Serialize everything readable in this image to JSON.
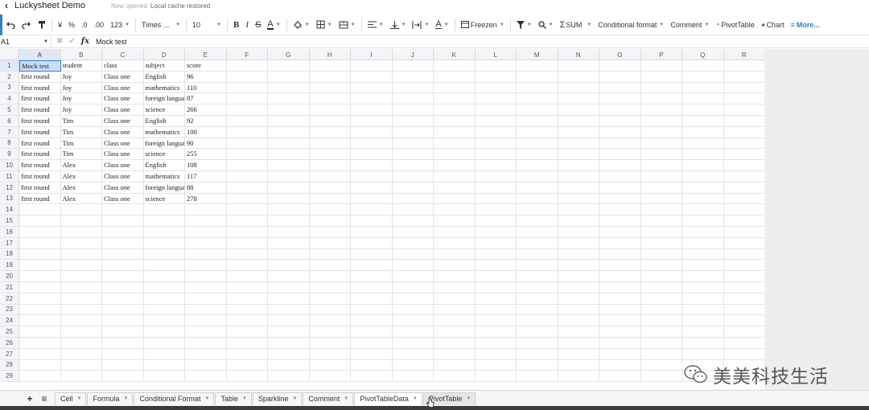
{
  "titlebar": {
    "title": "Luckysheet Demo",
    "status_opened": "New opened",
    "status_cache": "Local cache restored"
  },
  "toolbar": {
    "currency": "¥",
    "percent": "%",
    "dec_decrease": ".0",
    "dec_increase": ".00",
    "number_format": "123",
    "font_name": "Times ...",
    "font_size": "10",
    "bold": "B",
    "italic": "I",
    "strike": "S",
    "font_color": "A",
    "freeze": "Freezen",
    "sum": "SUM",
    "conditional_format": "Conditional format",
    "comment": "Comment",
    "pivot": "PivotTable",
    "chart": "Chart",
    "more": "More..."
  },
  "formula": {
    "cell_ref": "A1",
    "fx": "fx",
    "value": "Mock test"
  },
  "columns": [
    "A",
    "B",
    "C",
    "D",
    "E",
    "F",
    "G",
    "H",
    "I",
    "J",
    "K",
    "L",
    "M",
    "N",
    "O",
    "P",
    "Q",
    "R"
  ],
  "rows": [
    [
      "Mock test",
      "student",
      "class",
      "subject",
      "score"
    ],
    [
      "first round",
      "Joy",
      "Class one",
      "English",
      "96"
    ],
    [
      "first round",
      "Joy",
      "Class one",
      "mathematics",
      "110"
    ],
    [
      "first round",
      "Joy",
      "Class one",
      "foreign language",
      "87"
    ],
    [
      "first round",
      "Joy",
      "Class one",
      "science",
      "266"
    ],
    [
      "first round",
      "Tim",
      "Class one",
      "English",
      "92"
    ],
    [
      "first round",
      "Tim",
      "Class one",
      "mathematics",
      "100"
    ],
    [
      "first round",
      "Tim",
      "Class one",
      "foreign language",
      "90"
    ],
    [
      "first round",
      "Tim",
      "Class one",
      "science",
      "255"
    ],
    [
      "first round",
      "Alex",
      "Class one",
      "English",
      "108"
    ],
    [
      "first round",
      "Alex",
      "Class one",
      "mathematics",
      "117"
    ],
    [
      "first round",
      "Alex",
      "Class one",
      "foreign language",
      "88"
    ],
    [
      "first round",
      "Alex",
      "Class one",
      "science",
      "278"
    ]
  ],
  "row_count": 29,
  "sheets": [
    {
      "label": "Cell"
    },
    {
      "label": "Formula"
    },
    {
      "label": "Conditional Format"
    },
    {
      "label": "Table"
    },
    {
      "label": "Sparkline"
    },
    {
      "label": "Comment"
    },
    {
      "label": "PivotTableData",
      "active": true
    },
    {
      "label": "PivotTable",
      "hover": true
    }
  ],
  "watermark": "美美科技生活",
  "colors": {
    "accent": "#2b7fd8",
    "selection": "#c9ddf7"
  }
}
